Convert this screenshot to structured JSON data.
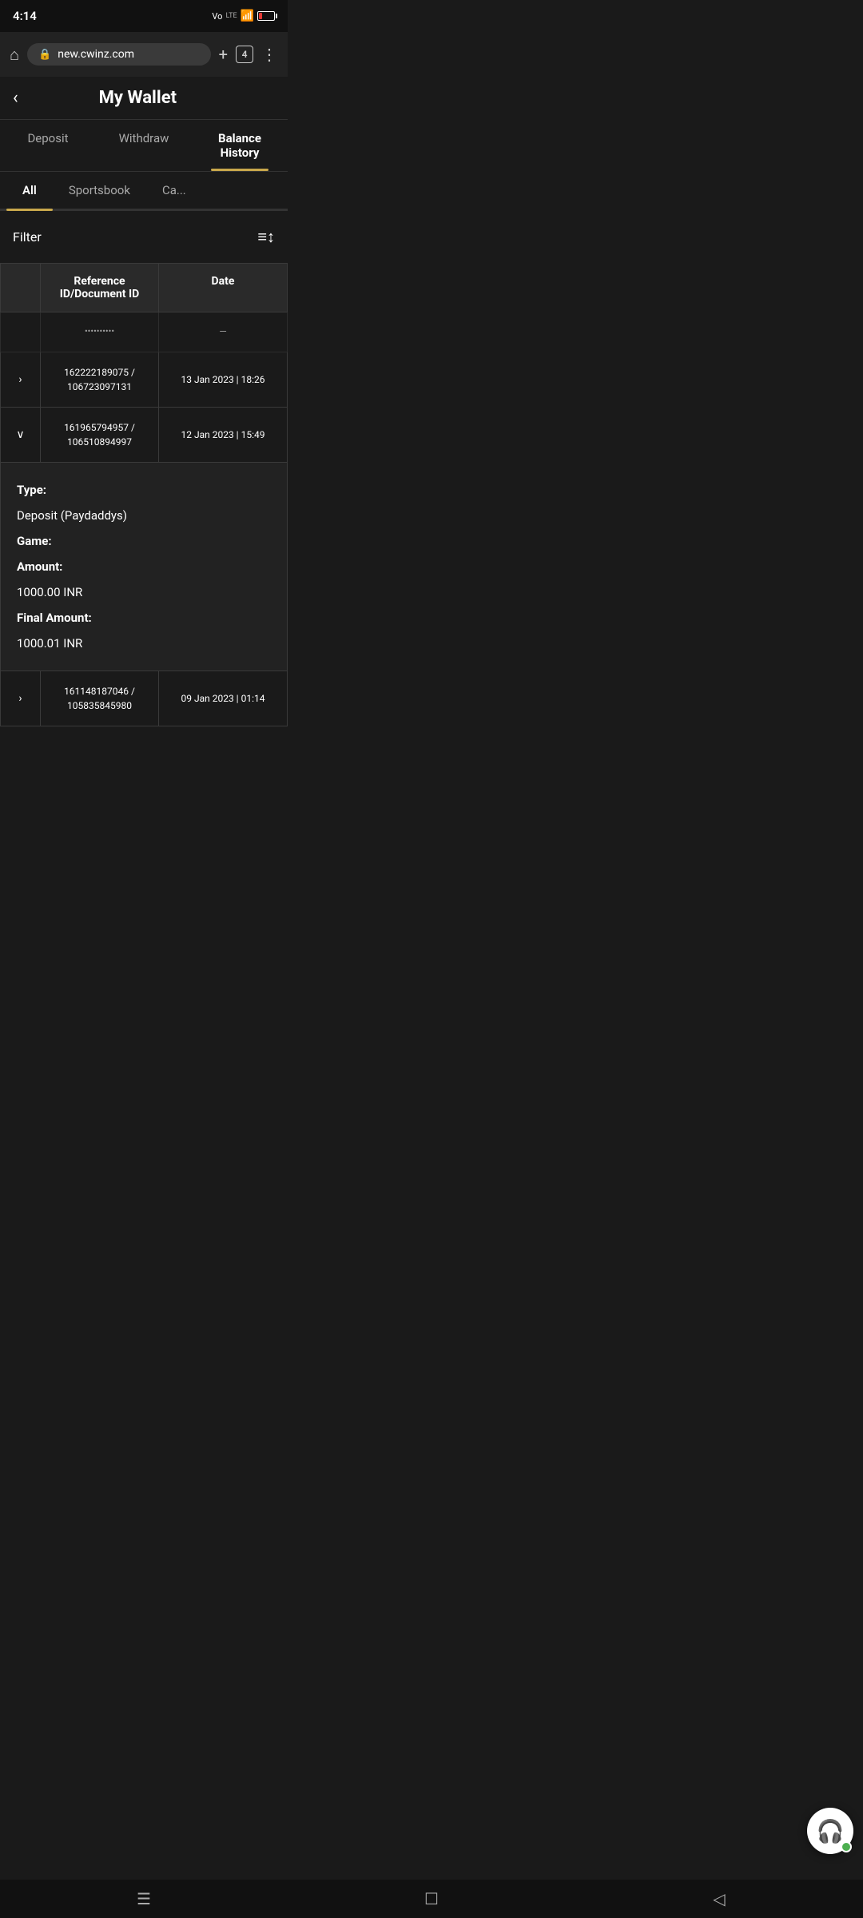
{
  "statusBar": {
    "time": "4:14",
    "network": "Vo 4G",
    "tabs_count": "4"
  },
  "browserBar": {
    "url": "new.cwinz.com",
    "tabs_count": "4"
  },
  "header": {
    "back_label": "‹",
    "title": "My Wallet"
  },
  "mainTabs": [
    {
      "id": "deposit",
      "label": "Deposit",
      "active": false
    },
    {
      "id": "withdraw",
      "label": "Withdraw",
      "active": false
    },
    {
      "id": "balance-history",
      "label": "Balance History",
      "active": true
    }
  ],
  "subTabs": [
    {
      "id": "all",
      "label": "All",
      "active": true
    },
    {
      "id": "sportsbook",
      "label": "Sportsbook",
      "active": false
    },
    {
      "id": "casino",
      "label": "Ca...",
      "active": false
    }
  ],
  "filterBar": {
    "label": "Filter",
    "icon": "≡↕"
  },
  "tableHeaders": {
    "col1": "",
    "col2": "Reference ID/Document ID",
    "col3": "Date"
  },
  "tableRows": [
    {
      "id": "row-truncated",
      "chevron": "",
      "refId": "...",
      "date": "..."
    },
    {
      "id": "row-1",
      "chevron": "›",
      "refId": "162222189075 / 106723097131",
      "date": "13 Jan 2023 | 18:26",
      "expanded": false
    },
    {
      "id": "row-2",
      "chevron": "⌄",
      "refId": "161965794957 / 106510894997",
      "date": "12 Jan 2023 | 15:49",
      "expanded": true,
      "detail": {
        "type_label": "Type:",
        "type_value": "Deposit (Paydaddys)",
        "game_label": "Game:",
        "game_value": "",
        "amount_label": "Amount:",
        "amount_value": "1000.00 INR",
        "final_label": "Final Amount:",
        "final_value": "1000.01 INR"
      }
    },
    {
      "id": "row-3",
      "chevron": "›",
      "refId": "161148187046 / 105835845980",
      "date": "09 Jan 2023 | 01:14",
      "expanded": false
    }
  ],
  "bottomNav": {
    "menu_icon": "☰",
    "home_icon": "☐",
    "back_icon": "◁"
  }
}
